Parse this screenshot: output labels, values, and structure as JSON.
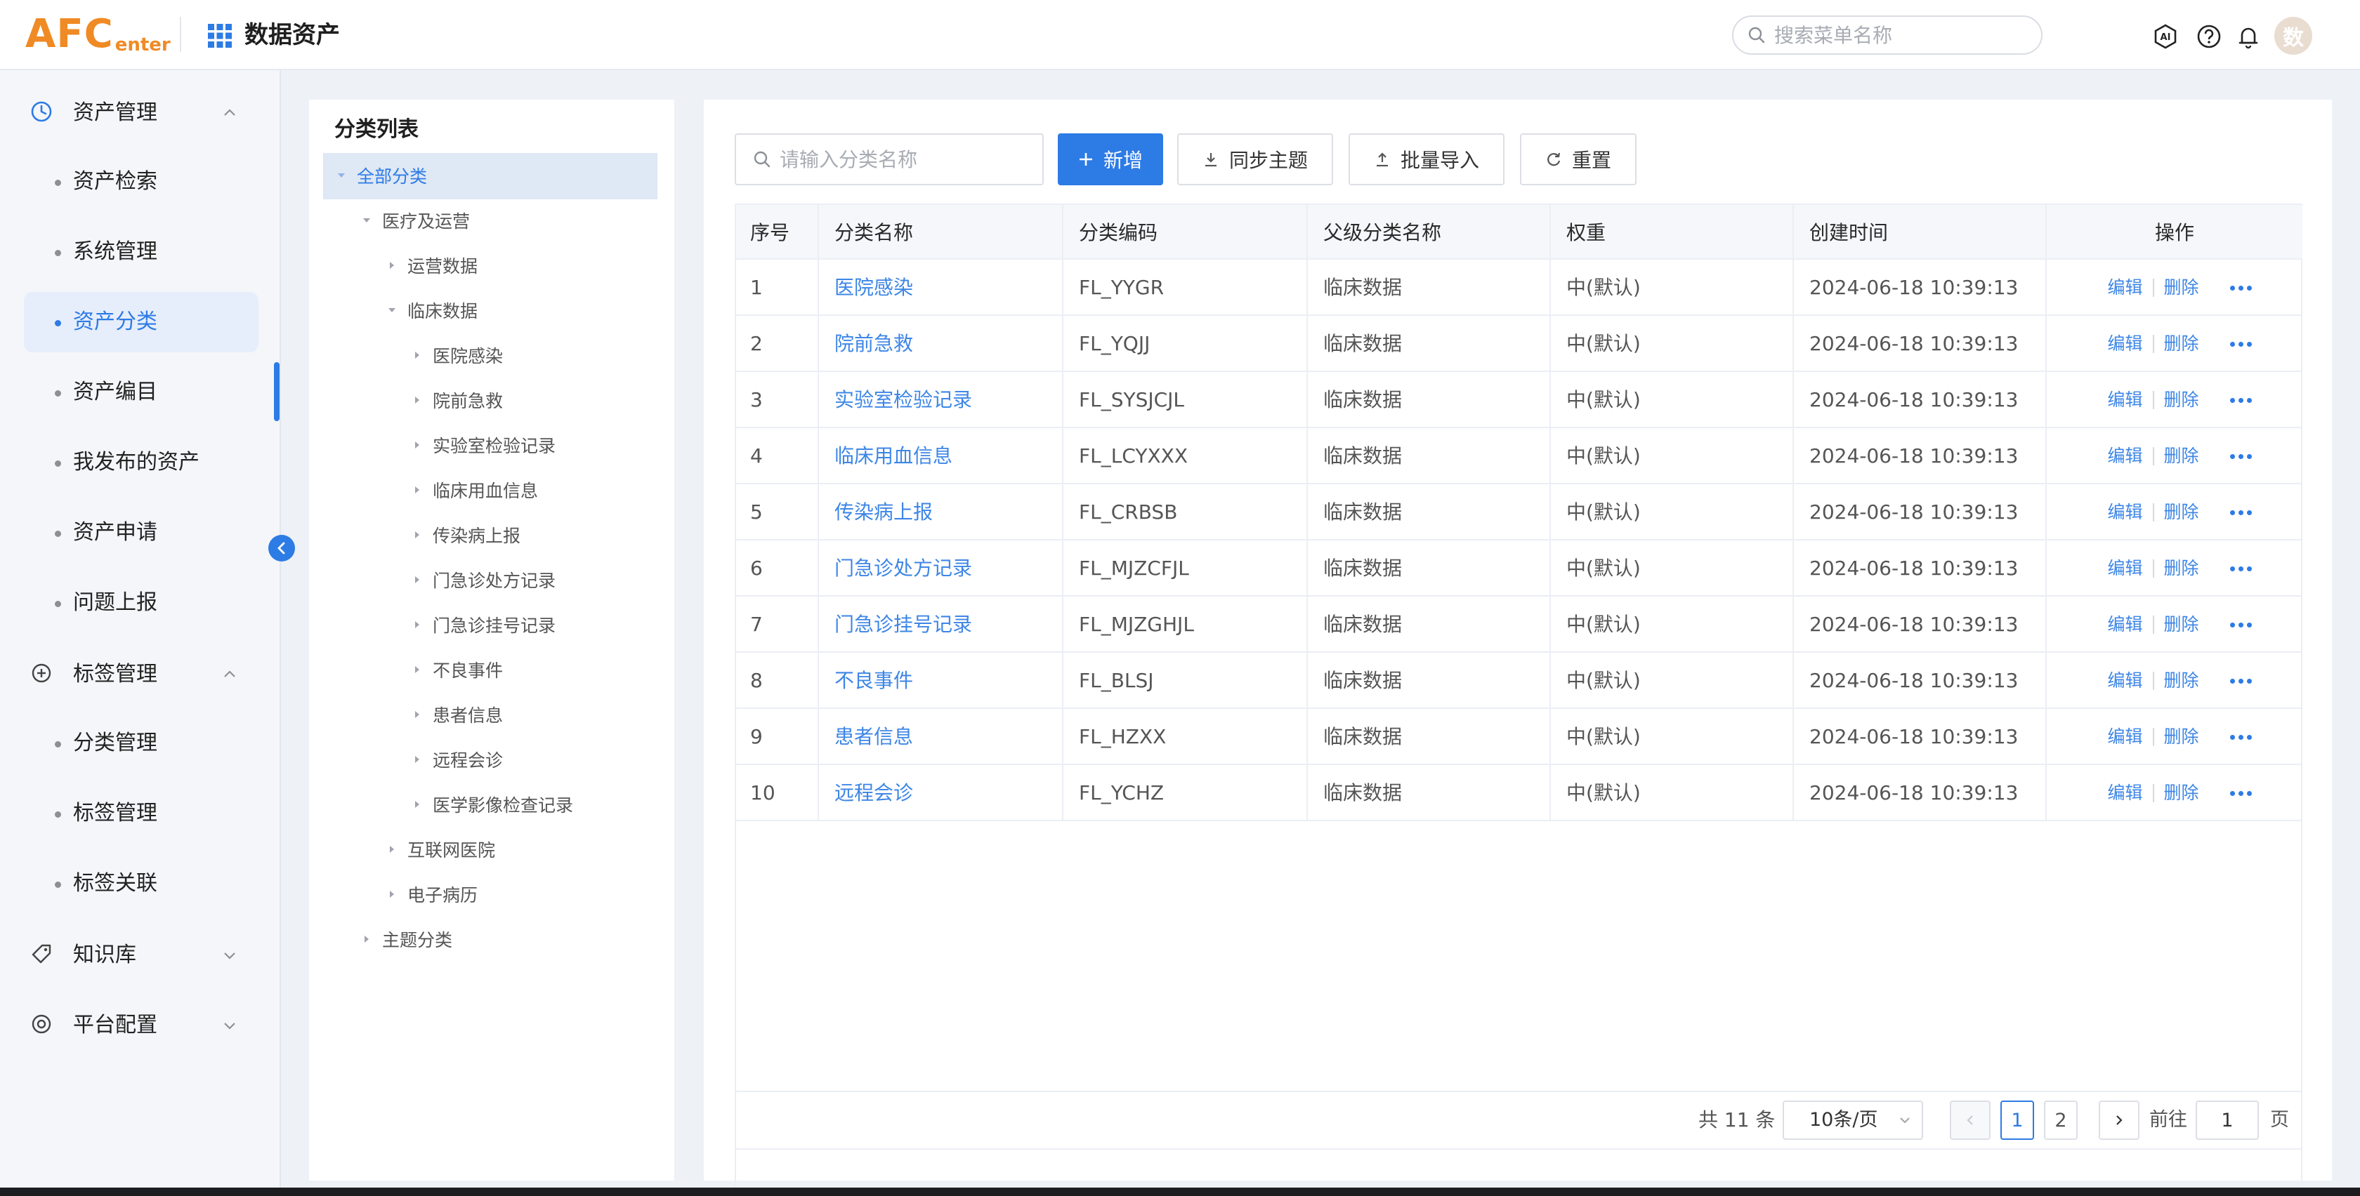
{
  "header": {
    "logo_main": "AFC",
    "logo_sub": "enter",
    "app_title": "数据资产",
    "search_placeholder": "搜索菜单名称",
    "avatar_text": "数"
  },
  "sidebar": {
    "groups": [
      {
        "label": "资产管理",
        "icon": "clock-icon",
        "expanded": true
      },
      {
        "label": "标签管理",
        "icon": "plus-circle-icon",
        "expanded": true
      },
      {
        "label": "知识库",
        "icon": "tag-icon",
        "expanded": false
      },
      {
        "label": "平台配置",
        "icon": "settings-icon",
        "expanded": false
      }
    ],
    "asset_items": [
      "资产检索",
      "系统管理",
      "资产分类",
      "资产编目",
      "我发布的资产",
      "资产申请",
      "问题上报"
    ],
    "tag_items": [
      "分类管理",
      "标签管理",
      "标签关联"
    ],
    "active_item": "资产分类"
  },
  "tree": {
    "title": "分类列表",
    "nodes": [
      {
        "label": "全部分类",
        "level": 0,
        "state": "open",
        "selected": true
      },
      {
        "label": "医疗及运营",
        "level": 1,
        "state": "open"
      },
      {
        "label": "运营数据",
        "level": 2,
        "state": "closed"
      },
      {
        "label": "临床数据",
        "level": 2,
        "state": "open"
      },
      {
        "label": "医院感染",
        "level": 3,
        "state": "closed"
      },
      {
        "label": "院前急救",
        "level": 3,
        "state": "closed"
      },
      {
        "label": "实验室检验记录",
        "level": 3,
        "state": "closed"
      },
      {
        "label": "临床用血信息",
        "level": 3,
        "state": "closed"
      },
      {
        "label": "传染病上报",
        "level": 3,
        "state": "closed"
      },
      {
        "label": "门急诊处方记录",
        "level": 3,
        "state": "closed"
      },
      {
        "label": "门急诊挂号记录",
        "level": 3,
        "state": "closed"
      },
      {
        "label": "不良事件",
        "level": 3,
        "state": "closed"
      },
      {
        "label": "患者信息",
        "level": 3,
        "state": "closed"
      },
      {
        "label": "远程会诊",
        "level": 3,
        "state": "closed"
      },
      {
        "label": "医学影像检查记录",
        "level": 3,
        "state": "closed"
      },
      {
        "label": "互联网医院",
        "level": 2,
        "state": "closed"
      },
      {
        "label": "电子病历",
        "level": 2,
        "state": "closed"
      },
      {
        "label": "主题分类",
        "level": 1,
        "state": "closed"
      }
    ]
  },
  "toolbar": {
    "search_placeholder": "请输入分类名称",
    "add_label": "新增",
    "sync_label": "同步主题",
    "import_label": "批量导入",
    "reset_label": "重置"
  },
  "table": {
    "columns": [
      "序号",
      "分类名称",
      "分类编码",
      "父级分类名称",
      "权重",
      "创建时间",
      "操作"
    ],
    "op_edit": "编辑",
    "op_delete": "删除",
    "rows": [
      [
        "1",
        "医院感染",
        "FL_YYGR",
        "临床数据",
        "中(默认)",
        "2024-06-18 10:39:13"
      ],
      [
        "2",
        "院前急救",
        "FL_YQJJ",
        "临床数据",
        "中(默认)",
        "2024-06-18 10:39:13"
      ],
      [
        "3",
        "实验室检验记录",
        "FL_SYSJCJL",
        "临床数据",
        "中(默认)",
        "2024-06-18 10:39:13"
      ],
      [
        "4",
        "临床用血信息",
        "FL_LCYXXX",
        "临床数据",
        "中(默认)",
        "2024-06-18 10:39:13"
      ],
      [
        "5",
        "传染病上报",
        "FL_CRBSB",
        "临床数据",
        "中(默认)",
        "2024-06-18 10:39:13"
      ],
      [
        "6",
        "门急诊处方记录",
        "FL_MJZCFJL",
        "临床数据",
        "中(默认)",
        "2024-06-18 10:39:13"
      ],
      [
        "7",
        "门急诊挂号记录",
        "FL_MJZGHJL",
        "临床数据",
        "中(默认)",
        "2024-06-18 10:39:13"
      ],
      [
        "8",
        "不良事件",
        "FL_BLSJ",
        "临床数据",
        "中(默认)",
        "2024-06-18 10:39:13"
      ],
      [
        "9",
        "患者信息",
        "FL_HZXX",
        "临床数据",
        "中(默认)",
        "2024-06-18 10:39:13"
      ],
      [
        "10",
        "远程会诊",
        "FL_YCHZ",
        "临床数据",
        "中(默认)",
        "2024-06-18 10:39:13"
      ]
    ]
  },
  "pagination": {
    "total_text": "共 11 条",
    "page_size": "10条/页",
    "pages": [
      "1",
      "2"
    ],
    "current_page": "1",
    "goto_prefix": "前往",
    "goto_value": "1",
    "goto_suffix": "页"
  },
  "colors": {
    "accent": "#2d7be5",
    "logo": "#f08a24",
    "link": "#3d86e6"
  }
}
